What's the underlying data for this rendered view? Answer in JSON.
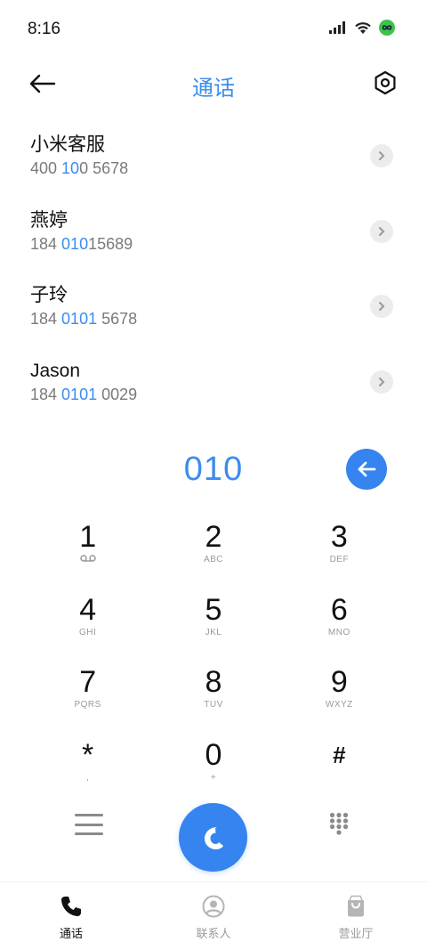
{
  "status_bar": {
    "time": "8:16",
    "icons": [
      "signal-icon",
      "wifi-icon",
      "app-status-icon"
    ]
  },
  "header": {
    "title": "通话",
    "back_icon": "arrow-left-icon",
    "settings_icon": "hexagon-settings-icon"
  },
  "contacts": [
    {
      "name": "小米客服",
      "number_parts": [
        "400 ",
        "10",
        "0 5678"
      ],
      "highlight": [
        false,
        true,
        false
      ]
    },
    {
      "name": "燕婷",
      "number_parts": [
        "184 ",
        "010",
        "15689"
      ],
      "highlight": [
        false,
        true,
        false
      ]
    },
    {
      "name": "子玲",
      "number_parts": [
        "184 ",
        "0101",
        " 5678"
      ],
      "highlight": [
        false,
        true,
        false
      ]
    },
    {
      "name": "Jason",
      "number_parts": [
        "184 ",
        "0101",
        " 0029"
      ],
      "highlight": [
        false,
        true,
        false
      ]
    }
  ],
  "dialed": {
    "number": "010",
    "backspace_icon": "backspace-arrow-icon"
  },
  "keypad": [
    {
      "digit": "1",
      "letters": "",
      "voicemail": true
    },
    {
      "digit": "2",
      "letters": "ABC"
    },
    {
      "digit": "3",
      "letters": "DEF"
    },
    {
      "digit": "4",
      "letters": "GHI"
    },
    {
      "digit": "5",
      "letters": "JKL"
    },
    {
      "digit": "6",
      "letters": "MNO"
    },
    {
      "digit": "7",
      "letters": "PQRS"
    },
    {
      "digit": "8",
      "letters": "TUV"
    },
    {
      "digit": "9",
      "letters": "WXYZ"
    },
    {
      "digit": "*",
      "letters": ","
    },
    {
      "digit": "0",
      "letters": "+"
    },
    {
      "digit": "#",
      "letters": ""
    }
  ],
  "actions": {
    "menu_icon": "menu-icon",
    "call_icon": "phone-call-icon",
    "dialpad_icon": "dialpad-toggle-icon"
  },
  "bottom_nav": [
    {
      "label": "通话",
      "icon": "phone-icon",
      "active": true
    },
    {
      "label": "联系人",
      "icon": "contacts-icon",
      "active": false
    },
    {
      "label": "营业厅",
      "icon": "store-bag-icon",
      "active": false
    }
  ],
  "colors": {
    "accent": "#3a8cf0",
    "call_button": "#3584ef",
    "text_primary": "#111111",
    "text_secondary": "#7a7a7a"
  }
}
